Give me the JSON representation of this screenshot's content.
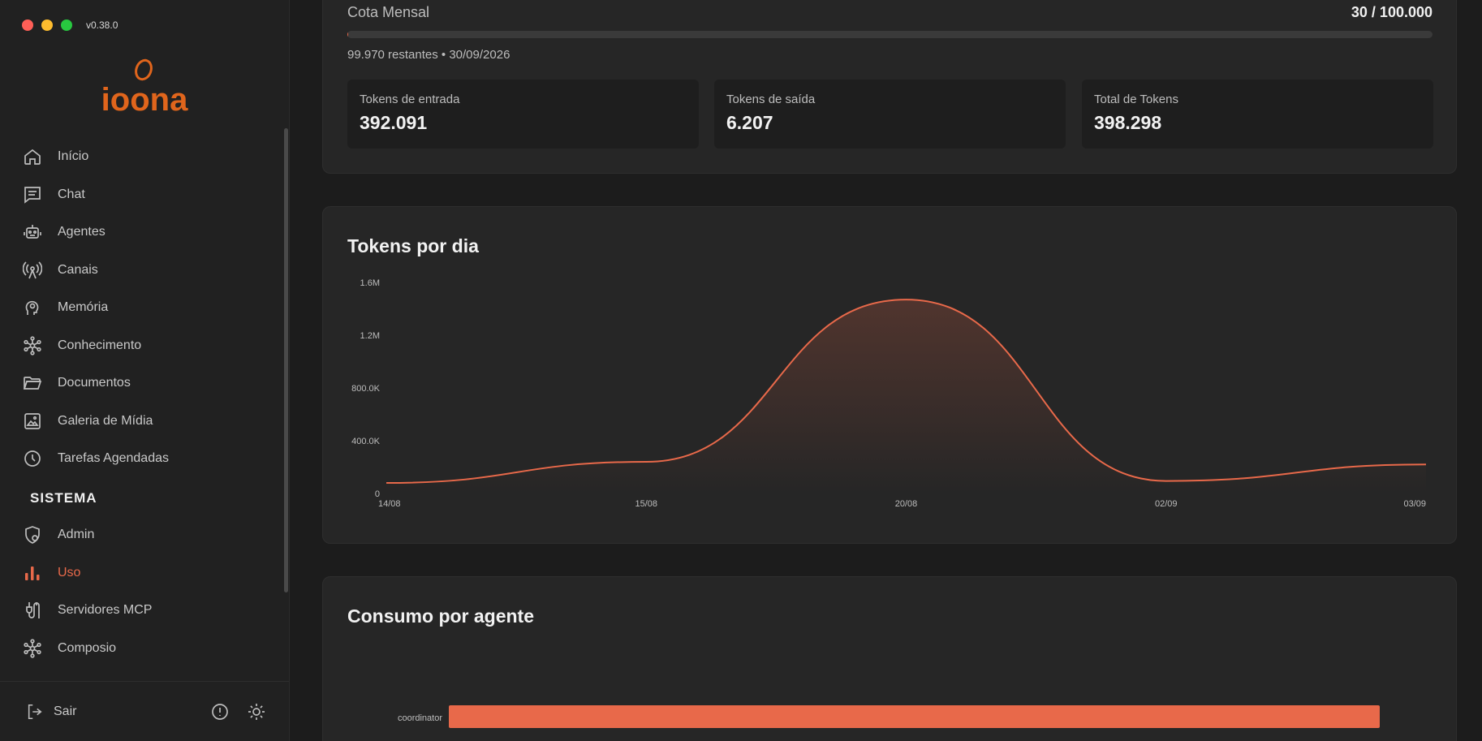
{
  "window": {
    "version": "v0.38.0"
  },
  "brand": {
    "logo": "ioona",
    "accent": "#e8694a"
  },
  "nav": {
    "items": [
      {
        "label": "Início",
        "icon": "home-icon"
      },
      {
        "label": "Chat",
        "icon": "chat-icon"
      },
      {
        "label": "Agentes",
        "icon": "robot-icon"
      },
      {
        "label": "Canais",
        "icon": "antenna-icon"
      },
      {
        "label": "Memória",
        "icon": "brain-icon"
      },
      {
        "label": "Conhecimento",
        "icon": "network-icon"
      },
      {
        "label": "Documentos",
        "icon": "folder-icon"
      },
      {
        "label": "Galeria de Mídia",
        "icon": "image-icon"
      },
      {
        "label": "Tarefas Agendadas",
        "icon": "clock-icon"
      }
    ],
    "section_label": "SISTEMA",
    "system_items": [
      {
        "label": "Admin",
        "icon": "shield-icon"
      },
      {
        "label": "Uso",
        "icon": "bar-chart-icon",
        "active": true
      },
      {
        "label": "Servidores MCP",
        "icon": "plug-icon"
      },
      {
        "label": "Composio",
        "icon": "network-icon"
      }
    ],
    "logout_label": "Sair"
  },
  "quota": {
    "title": "Cota Mensal",
    "value": "30 / 100.000",
    "used_fraction": 0.0003,
    "subtitle": "99.970 restantes • 30/09/2026"
  },
  "stats": [
    {
      "label": "Tokens de entrada",
      "value": "392.091"
    },
    {
      "label": "Tokens de saída",
      "value": "6.207"
    },
    {
      "label": "Total de Tokens",
      "value": "398.298"
    }
  ],
  "tokens_chart": {
    "title": "Tokens por dia"
  },
  "agent_chart": {
    "title": "Consumo por agente"
  },
  "chart_data": [
    {
      "type": "area",
      "title": "Tokens por dia",
      "x": [
        "14/08",
        "15/08",
        "20/08",
        "02/09",
        "03/09"
      ],
      "series": [
        {
          "values": [
            80000,
            240000,
            1470000,
            95000,
            220000
          ],
          "color": "#e8694a"
        }
      ],
      "yticks": [
        "0",
        "400.0K",
        "800.0K",
        "1.2M",
        "1.6M"
      ],
      "ylim": [
        0,
        1600000
      ],
      "grid": false
    },
    {
      "type": "bar",
      "title": "Consumo por agente",
      "orientation": "horizontal",
      "categories": [
        "coordinator"
      ],
      "values": [
        398298
      ],
      "color": "#e8694a"
    }
  ]
}
